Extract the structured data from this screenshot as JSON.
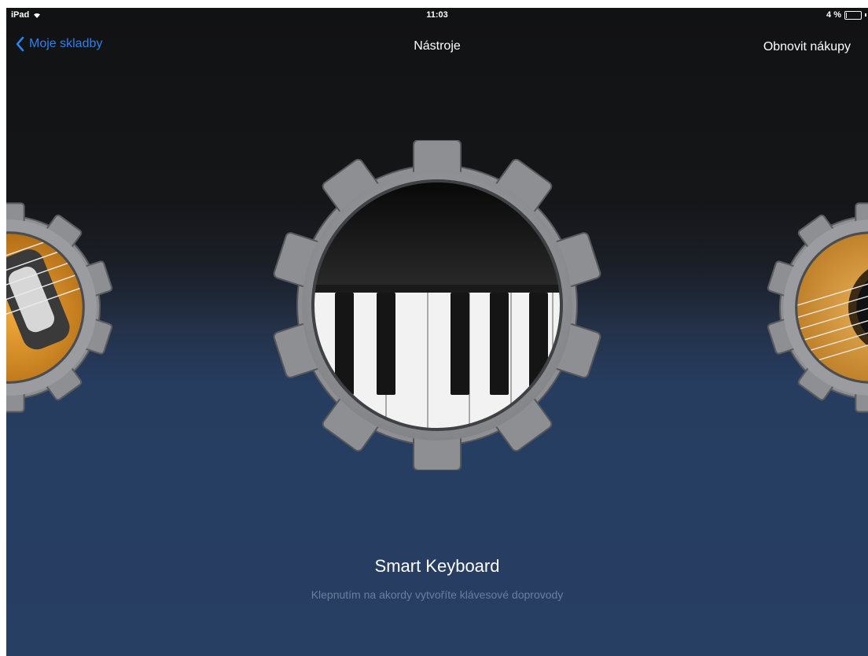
{
  "status_bar": {
    "device": "iPad",
    "time": "11:03",
    "battery_percent": "4 %"
  },
  "nav": {
    "back_label": "Moje skladby",
    "title": "Nástroje",
    "restore_label": "Obnovit nákupy"
  },
  "carousel": {
    "current": {
      "name": "Smart Keyboard",
      "description": "Klepnutím na akordy vytvoříte klávesové doprovody",
      "icon": "piano-keyboard-icon"
    },
    "previous_icon": "electric-guitar-icon",
    "next_icon": "acoustic-guitar-icon"
  },
  "colors": {
    "accent": "#2a82f0",
    "background_top": "#111214",
    "background_bottom": "#273f63",
    "gear": "#8d8f93",
    "description": "#6a7f9e"
  }
}
